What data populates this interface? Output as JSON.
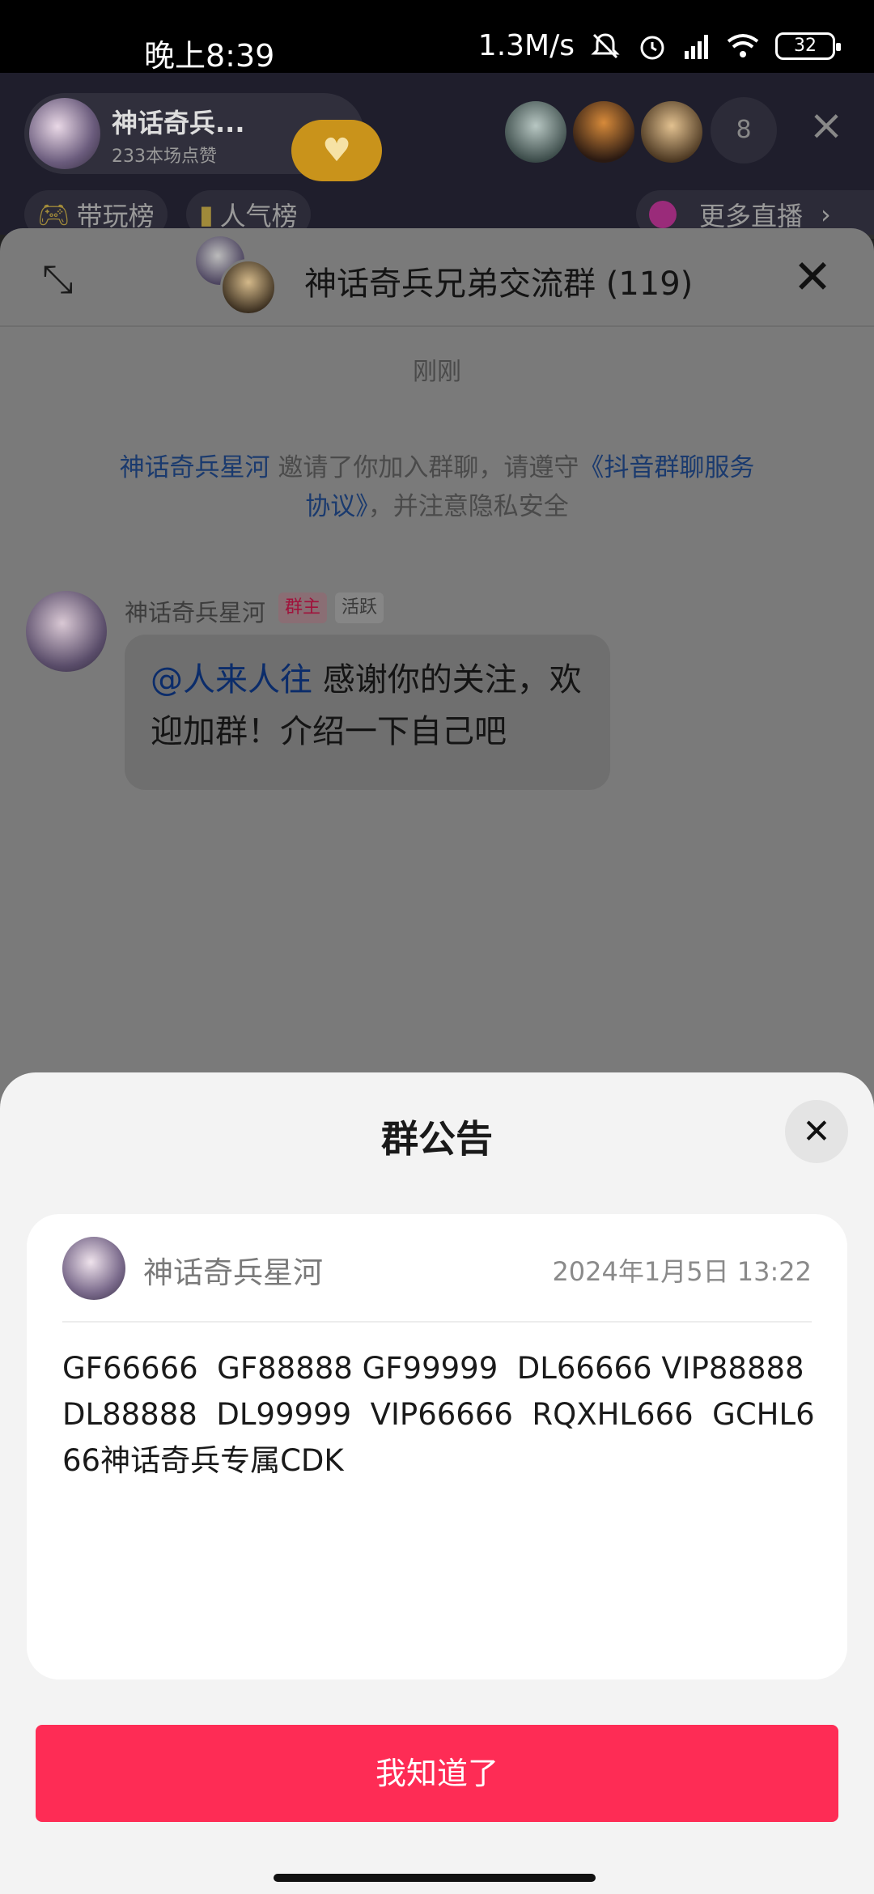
{
  "status_bar": {
    "time": "晚上8:39",
    "network_speed": "1.3M/s",
    "battery": "32",
    "icons": [
      "mute-icon",
      "alarm-icon",
      "signal-icon",
      "wifi-icon",
      "battery-icon"
    ]
  },
  "live": {
    "host_name": "神话奇兵...",
    "host_likes": "233本场点赞",
    "follow_icon": "heart-icon",
    "viewer_count": "8",
    "chips": {
      "play_rank": "带玩榜",
      "popularity_rank": "人气榜",
      "more_live": "更多直播"
    }
  },
  "chat": {
    "title": "神话奇兵兄弟交流群 (119)",
    "time_label": "刚刚",
    "system_message": {
      "inviter": "神话奇兵星河",
      "text_middle": " 邀请了你加入群聊，请遵守",
      "agreement": "《抖音群聊服务协议》",
      "text_end": "，并注意隐私安全"
    },
    "message": {
      "sender": "神话奇兵星河",
      "badge_owner": "群主",
      "badge_active": "活跃",
      "mention": "@人来人往",
      "text": " 感谢你的关注，欢迎加群！介绍一下自己吧"
    }
  },
  "announcement": {
    "title": "群公告",
    "author": "神话奇兵星河",
    "date": "2024年1月5日 13:22",
    "body": "GF66666  GF88888 GF99999  DL66666 VIP88888  DL88888  DL99999  VIP66666  RQXHL666  GCHL666神话奇兵专属CDK",
    "confirm_label": "我知道了"
  },
  "colors": {
    "accent": "#fe2c55",
    "sheet_bg": "#f3f3f3",
    "link": "#1a3a6e"
  }
}
